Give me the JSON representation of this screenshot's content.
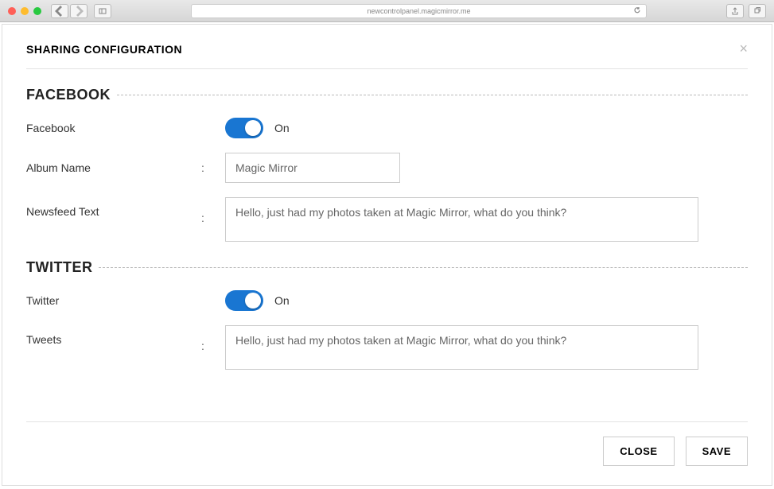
{
  "browser": {
    "url": "newcontrolpanel.magicmirror.me"
  },
  "modal": {
    "title": "SHARING CONFIGURATION"
  },
  "facebook": {
    "heading": "FACEBOOK",
    "toggle_label": "Facebook",
    "toggle_state": "On",
    "album_label": "Album Name",
    "album_value": "Magic Mirror",
    "newsfeed_label": "Newsfeed Text",
    "newsfeed_value": "Hello, just had my photos taken at Magic Mirror, what do you think?"
  },
  "twitter": {
    "heading": "TWITTER",
    "toggle_label": "Twitter",
    "toggle_state": "On",
    "tweets_label": "Tweets",
    "tweets_value": "Hello, just had my photos taken at Magic Mirror, what do you think?"
  },
  "footer": {
    "close_label": "CLOSE",
    "save_label": "SAVE"
  }
}
